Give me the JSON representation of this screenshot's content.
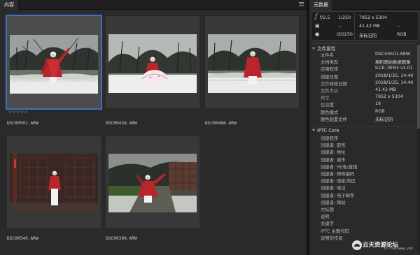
{
  "content_panel": {
    "tab_label": "内容",
    "thumbnails": [
      {
        "filename": "DSC00501.ARW",
        "selected": true,
        "rating": "☆☆☆☆☆"
      },
      {
        "filename": "DSC00438.ARW",
        "selected": false
      },
      {
        "filename": "DSC00486.ARW",
        "selected": false
      },
      {
        "filename": "DSC00540.ARW",
        "selected": false
      },
      {
        "filename": "DSC00390.ARW",
        "selected": false
      }
    ]
  },
  "metadata_panel": {
    "tab_label": "元数据",
    "camera": {
      "aperture": "f/2.5",
      "shutter": "1/250",
      "iso": "ISO250",
      "dim1": "--",
      "dim2": "--",
      "dimensions": "7952 x 5304",
      "filesize": "41.42 MB",
      "untagged": "未标记的",
      "colormode": "RGB"
    },
    "file_properties": {
      "title": "文件属性",
      "rows": [
        {
          "key": "文件名",
          "value": "DSC00501.ARW"
        },
        {
          "key": "文档类型",
          "value": "相机原始数据图像"
        },
        {
          "key": "应用程序",
          "value": "ILCE-7RM3 v1.01"
        },
        {
          "key": "创建日期",
          "value": "2018/1/25, 14:40"
        },
        {
          "key": "文件修改日期",
          "value": "2018/1/25, 14:40"
        },
        {
          "key": "文件大小",
          "value": "41.42 MB"
        },
        {
          "key": "尺寸",
          "value": "7952 x 5304"
        },
        {
          "key": "位深度",
          "value": "16"
        },
        {
          "key": "颜色模式",
          "value": "RGB"
        },
        {
          "key": "颜色配置文件",
          "value": "未标记的"
        }
      ]
    },
    "iptc_core": {
      "title": "IPTC Core",
      "rows": [
        {
          "key": "创建程序"
        },
        {
          "key": "创建者: 职务"
        },
        {
          "key": "创建者: 地址"
        },
        {
          "key": "创建者: 城市"
        },
        {
          "key": "创建者: 州/省/直辖"
        },
        {
          "key": "创建者: 邮政编码"
        },
        {
          "key": "创建者: 国家/地区"
        },
        {
          "key": "创建者: 电话"
        },
        {
          "key": "创建者: 电子邮件"
        },
        {
          "key": "创建者: 网站"
        },
        {
          "key": "大标题"
        },
        {
          "key": "说明"
        },
        {
          "key": "关键字"
        },
        {
          "key": "IPTC 主题代码"
        },
        {
          "key": "说明的作者"
        }
      ]
    }
  },
  "watermark": {
    "text": "云天资源论坛",
    "sub": "ts.com/www.yun"
  },
  "colors": {
    "panel_bg": "#2a2a2a",
    "selection": "#3d74c0",
    "coat_red": "#b8262c"
  }
}
